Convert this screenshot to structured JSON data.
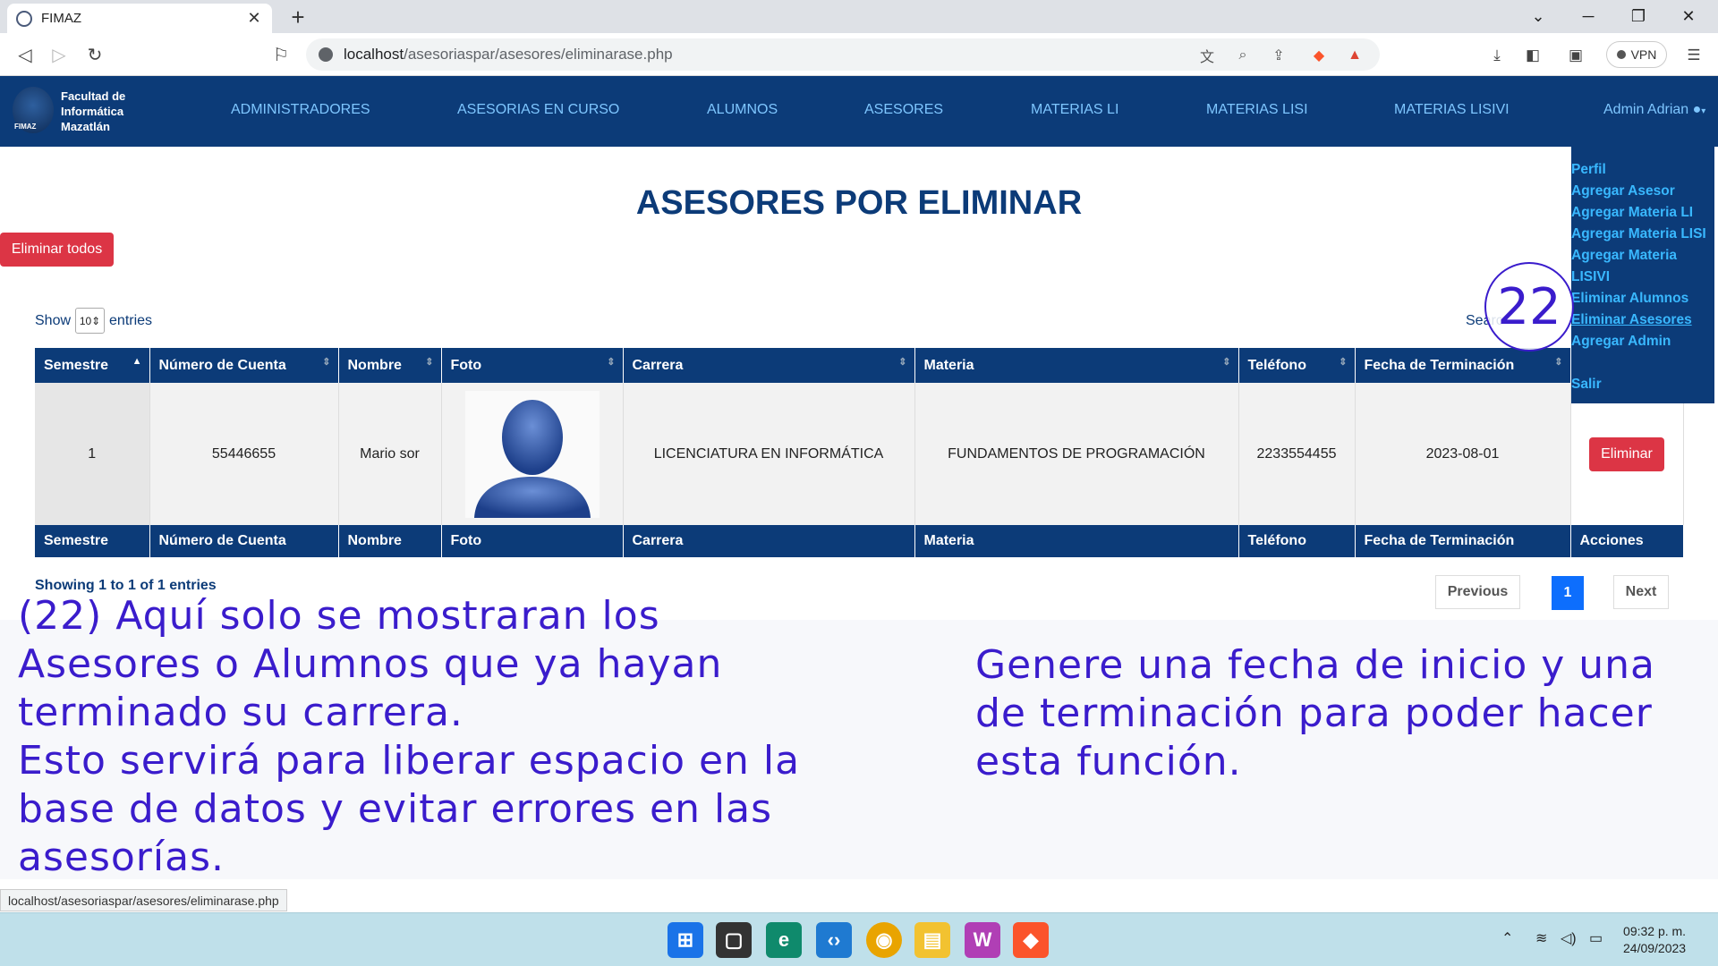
{
  "browser": {
    "tab_title": "FIMAZ",
    "url_host": "localhost",
    "url_path": "/asesoriaspar/asesores/eliminarase.php",
    "vpn_label": "VPN",
    "status_url": "localhost/asesoriaspar/asesores/eliminarase.php"
  },
  "site": {
    "brand_line1": "Facultad de",
    "brand_line2": "Informática",
    "brand_line3": "Mazatlán",
    "logo_text": "FIMAZ",
    "nav": [
      "ADMINISTRADORES",
      "ASESORIAS EN CURSO",
      "ALUMNOS",
      "ASESORES",
      "MATERIAS LI",
      "MATERIAS LISI",
      "MATERIAS LISIVI"
    ],
    "user": "Admin Adrian",
    "dropdown": [
      "Perfil",
      "Agregar Asesor",
      "Agregar Materia LI",
      "Agregar Materia LISI",
      "Agregar Materia LISIVI",
      "Eliminar Alumnos",
      "Eliminar Asesores",
      "Agregar Admin",
      "Salir"
    ]
  },
  "page": {
    "title": "ASESORES POR ELIMINAR",
    "delete_all": "Eliminar todos",
    "show": "Show",
    "entries": "entries",
    "page_length": "10",
    "search_label": "Search:",
    "info": "Showing 1 to 1 of 1 entries",
    "previous": "Previous",
    "current_page": "1",
    "next": "Next"
  },
  "table": {
    "headers": [
      "Semestre",
      "Número de Cuenta",
      "Nombre",
      "Foto",
      "Carrera",
      "Materia",
      "Teléfono",
      "Fecha de Terminación"
    ],
    "footer_headers": [
      "Semestre",
      "Número de Cuenta",
      "Nombre",
      "Foto",
      "Carrera",
      "Materia",
      "Teléfono",
      "Fecha de Terminación",
      "Acciones"
    ],
    "rows": [
      {
        "semestre": "1",
        "cuenta": "55446655",
        "nombre": "Mario sor",
        "carrera": "LICENCIATURA EN INFORMÁTICA",
        "materia": "FUNDAMENTOS DE PROGRAMACIÓN",
        "telefono": "2233554455",
        "fecha": "2023-08-01",
        "accion": "Eliminar"
      }
    ]
  },
  "annotations": {
    "badge": "22",
    "left_note": "(22) Aquí solo se mostraran los\nAsesores o Alumnos que ya hayan\nterminado su carrera.\nEsto servirá para liberar espacio en la\nbase de datos y evitar errores en las\nasesorías.",
    "right_note": "Genere una fecha de inicio y una\nde terminación para poder hacer\nesta función."
  },
  "taskbar": {
    "time": "09:32 p. m.",
    "date": "24/09/2023"
  },
  "colors": {
    "navy": "#0c3b78",
    "danger": "#dc3545",
    "annotation": "#3a1ccc",
    "pager_active": "#0d6efd"
  }
}
